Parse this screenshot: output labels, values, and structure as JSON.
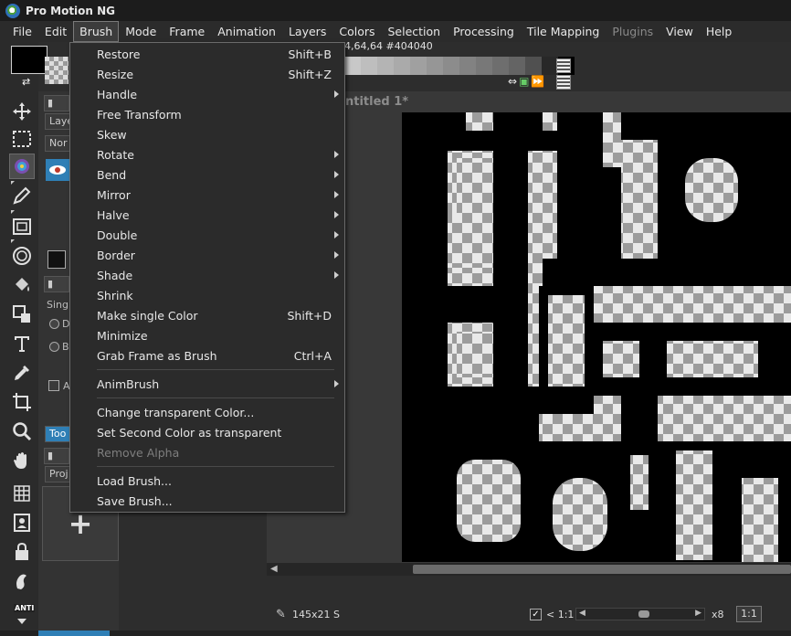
{
  "window": {
    "title": "Pro Motion NG"
  },
  "menubar": [
    {
      "label": "File"
    },
    {
      "label": "Edit"
    },
    {
      "label": "Brush",
      "active": true
    },
    {
      "label": "Mode"
    },
    {
      "label": "Frame"
    },
    {
      "label": "Animation"
    },
    {
      "label": "Layers"
    },
    {
      "label": "Colors"
    },
    {
      "label": "Selection"
    },
    {
      "label": "Processing"
    },
    {
      "label": "Tile Mapping"
    },
    {
      "label": "Plugins",
      "disabled": true
    },
    {
      "label": "View"
    },
    {
      "label": "Help"
    }
  ],
  "brush_menu": {
    "items": [
      {
        "label": "Restore",
        "shortcut": "Shift+B"
      },
      {
        "label": "Resize",
        "shortcut": "Shift+Z"
      },
      {
        "label": "Handle",
        "submenu": true
      },
      {
        "label": "Free Transform"
      },
      {
        "label": "Skew"
      },
      {
        "label": "Rotate",
        "submenu": true
      },
      {
        "label": "Bend",
        "submenu": true
      },
      {
        "label": "Mirror",
        "submenu": true
      },
      {
        "label": "Halve",
        "submenu": true
      },
      {
        "label": "Double",
        "submenu": true
      },
      {
        "label": "Border",
        "submenu": true
      },
      {
        "label": "Shade",
        "submenu": true
      },
      {
        "label": "Shrink"
      },
      {
        "label": "Make single Color",
        "shortcut": "Shift+D"
      },
      {
        "label": "Minimize"
      },
      {
        "label": "Grab Frame as Brush",
        "shortcut": "Ctrl+A"
      },
      {
        "separator": true
      },
      {
        "label": "AnimBrush",
        "submenu": true
      },
      {
        "separator": true
      },
      {
        "label": "Change transparent Color..."
      },
      {
        "label": "Set Second Color as transparent"
      },
      {
        "label": "Remove Alpha",
        "disabled": true
      },
      {
        "separator": true
      },
      {
        "label": "Load Brush..."
      },
      {
        "label": "Save Brush..."
      }
    ]
  },
  "palette": {
    "color_info": "4,64,64 #404040",
    "swatches": [
      "#c8c8c8",
      "#bebebe",
      "#b4b4b4",
      "#aaaaaa",
      "#a0a0a0",
      "#969696",
      "#8c8c8c",
      "#828282",
      "#787878",
      "#6e6e6e",
      "#646464",
      "#505050",
      "#282828",
      "#000000"
    ]
  },
  "left_panel": {
    "layers_tab": "Laye",
    "mode_value": "Nor",
    "single_label": "Singl",
    "radio_1": "D",
    "radio_2": "B",
    "check_label": "A",
    "tools_tab": "Too",
    "project_tab": "Proj",
    "new_project": "+"
  },
  "document": {
    "tab_title": "ntitled 1*"
  },
  "status": {
    "brush_size": "145x21 S",
    "ratio_checked": "✓",
    "ratio_label": "< 1:1",
    "zoom_level": "x8",
    "zoom_button": "1:1",
    "zoom_slider": 0.48
  },
  "toolbar": {
    "anti_label": "ANTI"
  }
}
